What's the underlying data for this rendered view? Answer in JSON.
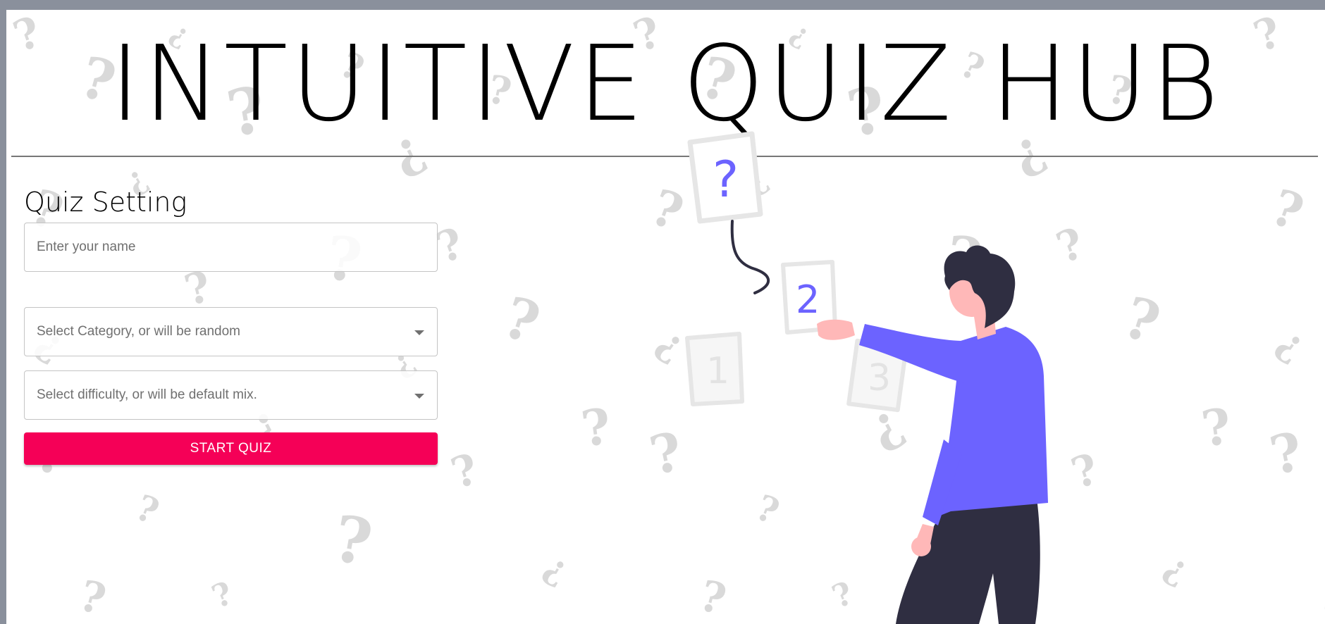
{
  "app": {
    "title": "INTUITIVE QUIZ HUB"
  },
  "quiz_setting": {
    "heading": "Quiz Setting",
    "name_input": {
      "placeholder": "Enter your name",
      "value": ""
    },
    "category_select": {
      "placeholder": "Select Category, or will be random"
    },
    "difficulty_select": {
      "placeholder": "Select difficulty, or will be default mix."
    },
    "start_button": {
      "label": "START QUIZ"
    }
  },
  "illustration": {
    "cards": [
      "?",
      "2",
      "1",
      "3"
    ]
  },
  "colors": {
    "accent": "#f50057",
    "illustration_purple": "#6c63ff",
    "illustration_dark": "#2f2e41",
    "skin": "#ffb8b8"
  }
}
